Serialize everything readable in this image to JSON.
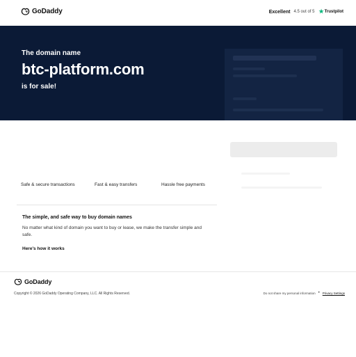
{
  "header": {
    "logo_text": "GoDaddy",
    "rating_label": "Excellent",
    "rating_value": "4.5 out of 5",
    "trustpilot_label": "Trustpilot",
    "accent_color": "#00b67a"
  },
  "hero": {
    "intro": "The domain name",
    "domain": "btc-platform.com",
    "sale_text": "is for sale!",
    "background": "#0b1a36"
  },
  "features": {
    "items": [
      {
        "label": "Safe & secure transactions"
      },
      {
        "label": "Fast & easy transfers"
      },
      {
        "label": "Hassle free payments"
      }
    ]
  },
  "info": {
    "title": "The simple, and safe way to buy domain names",
    "body": "No matter what kind of domain you want to buy or lease, we make the transfer simple and safe.",
    "link": "Here's how it works"
  },
  "footer": {
    "logo_text": "GoDaddy",
    "copyright": "Copyright © 2026 GoDaddy Operating Company, LLC. All Rights Reserved.",
    "privacy_link": "Do not share my personal information",
    "separator": "•",
    "settings_link": "Privacy Settings"
  }
}
